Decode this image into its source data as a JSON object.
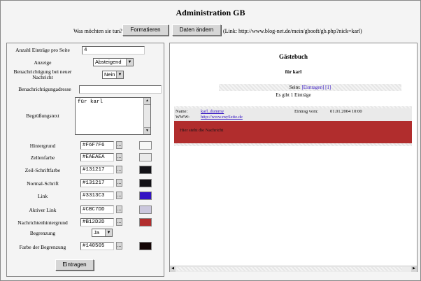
{
  "page": {
    "title": "Administration GB"
  },
  "toolbar": {
    "question": "Was möchten sie tun?",
    "format_button": "Formatieren",
    "data_button": "Daten ändern",
    "link_text": "(Link: http://www.blog-net.de/mein/gbooft/gb.php?nick=karl)"
  },
  "form": {
    "entries_per_page_label": "Anzahl Einträge pro Seite",
    "entries_per_page_value": "4",
    "display_label": "Anzeige",
    "display_value": "Absteigend",
    "notify_label": "Benachrichtigung bei neuer Nachricht",
    "notify_value": "Nein",
    "notify_address_label": "Benachrichtigungadresse",
    "notify_address_value": "",
    "greeting_label": "Begrüßungstext",
    "greeting_value": "für karl",
    "colors": [
      {
        "label": "Hintergrund",
        "value": "#F6F7F6",
        "swatch": "#F6F7F6"
      },
      {
        "label": "Zellenfarbe",
        "value": "#EAEAEA",
        "swatch": "#EAEAEA"
      },
      {
        "label": "Zeil-Schriftfarbe",
        "value": "#131217",
        "swatch": "#131217"
      },
      {
        "label": "Normal-Schrift",
        "value": "#131217",
        "swatch": "#131217"
      },
      {
        "label": "Link",
        "value": "#3313C3",
        "swatch": "#3313C3"
      },
      {
        "label": "Aktiver Link",
        "value": "#CBC7DD",
        "swatch": "#CBC7DD"
      },
      {
        "label": "Nachrichtenhintergrund",
        "value": "#B12D2D",
        "swatch": "#B12D2D"
      }
    ],
    "border_label": "Begrenzung",
    "border_value": "Ja",
    "border_color_label": "Farbe der Begrenzung",
    "border_color_value": "#140505",
    "border_color_swatch": "#140505",
    "submit_button": "Eintragen",
    "picker_glyph": "..."
  },
  "preview": {
    "title": "Gästebuch",
    "subtitle": "für karl",
    "pages_label": "Seite:",
    "pages_link_new": "[Eintragen]",
    "pages_link_1": "[1]",
    "count_text": "Es gibt 1 Einträge",
    "entry": {
      "name_label": "Name:",
      "name_value": "karl_dummy",
      "www_label": "WWW:",
      "www_value": "http://www.mySeite.de",
      "date_label": "Eintrag vom:",
      "date_value": "01.01.2004 10:00",
      "message": "Hier steht die Nachricht"
    }
  }
}
